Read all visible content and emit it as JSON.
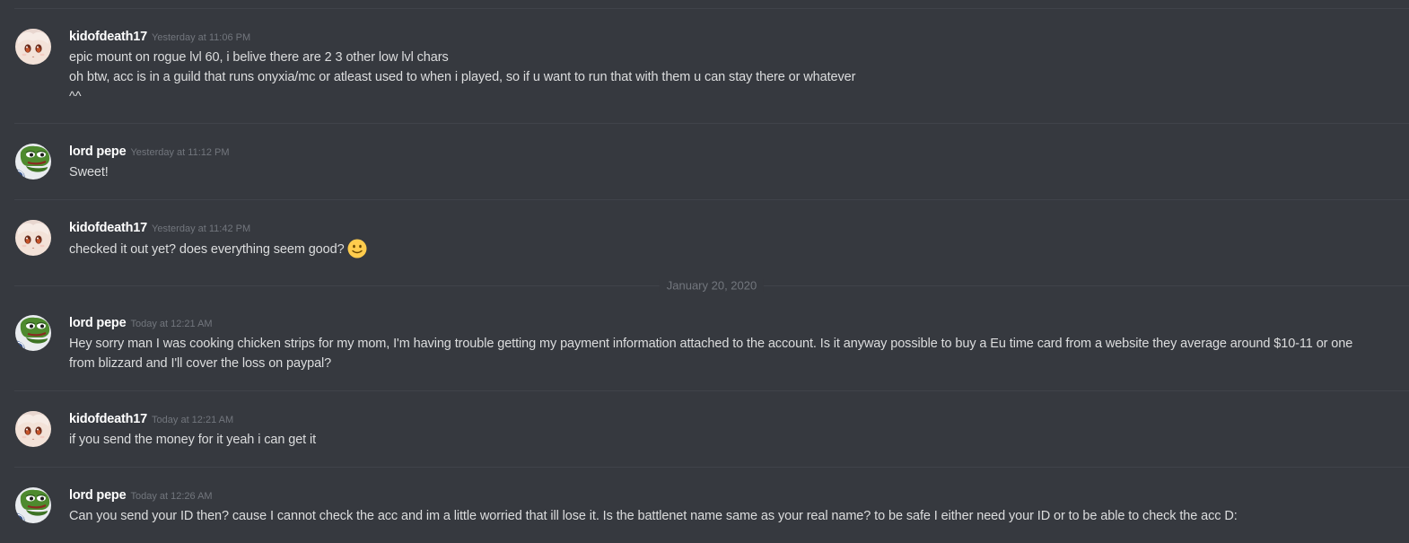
{
  "chat": {
    "date_divider_label": "January 20, 2020",
    "messages": [
      {
        "username": "kidofdeath17",
        "timestamp": "Yesterday at 11:06 PM",
        "avatar_icon": "anime-girl-avatar",
        "lines": [
          "epic mount on rogue lvl 60, i belive there are 2 3 other low lvl chars",
          "oh btw, acc is in a guild that runs onyxia/mc or atleast used to when i played, so if u want to run that with them u can stay there or whatever",
          "^^"
        ]
      },
      {
        "username": "lord pepe",
        "timestamp": "Yesterday at 11:12 PM",
        "avatar_icon": "pepe-frog-avatar",
        "lines": [
          "Sweet!"
        ]
      },
      {
        "username": "kidofdeath17",
        "timestamp": "Yesterday at 11:42 PM",
        "avatar_icon": "anime-girl-avatar",
        "lines": [
          "checked it out yet? does everything seem good?"
        ],
        "emoji": "slightly-smiling-face-emoji"
      },
      {
        "username": "lord pepe",
        "timestamp": "Today at 12:21 AM",
        "avatar_icon": "pepe-frog-avatar",
        "lines": [
          "Hey sorry man I was cooking chicken strips for my mom, I'm having trouble getting my payment information attached to the account. Is it anyway possible to buy a Eu time card from a website they average around $10-11 or one from blizzard and I'll cover the loss on paypal?"
        ]
      },
      {
        "username": "kidofdeath17",
        "timestamp": "Today at 12:21 AM",
        "avatar_icon": "anime-girl-avatar",
        "lines": [
          "if you send the money for it yeah i can get it"
        ]
      },
      {
        "username": "lord pepe",
        "timestamp": "Today at 12:26 AM",
        "avatar_icon": "pepe-frog-avatar",
        "lines": [
          "Can you send your ID then? cause I cannot check the acc and im a little worried that ill lose it. Is the battlenet name same as your real name? to be safe I either need your ID or to be able to check the acc D:"
        ]
      }
    ]
  },
  "colors": {
    "background": "#36393f",
    "username": "#ffffff",
    "message_text": "#dcddde",
    "timestamp": "#72767d",
    "divider": "#40434a"
  }
}
